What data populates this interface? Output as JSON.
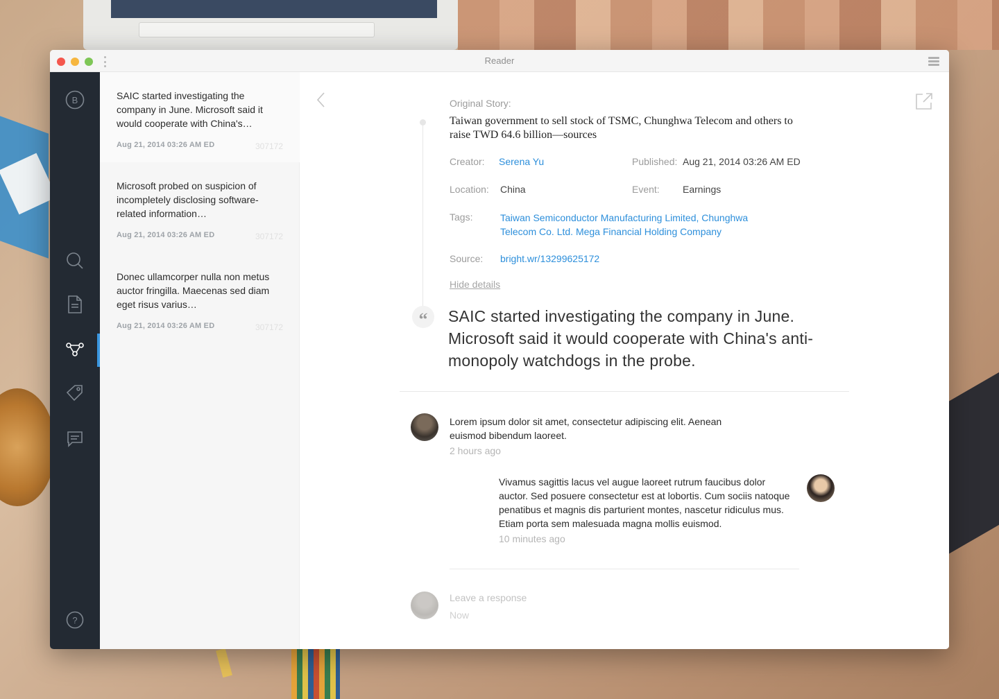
{
  "window": {
    "title": "Reader"
  },
  "sidebar": {
    "logo_letter": "B",
    "items": [
      {
        "name": "search-icon"
      },
      {
        "name": "document-icon"
      },
      {
        "name": "graph-icon",
        "active": true
      },
      {
        "name": "tag-icon"
      },
      {
        "name": "comment-icon"
      }
    ],
    "help": "?"
  },
  "list": {
    "items": [
      {
        "text": "SAIC started investigating the company in June. Microsoft said it would cooperate with China's…",
        "date": "Aug 21, 2014 03:26 AM ED",
        "id": "307172",
        "selected": true
      },
      {
        "text": "Microsoft probed on suspicion of incompletely disclosing software-related information…",
        "date": "Aug 21, 2014 03:26 AM ED",
        "id": "307172"
      },
      {
        "text": "Donec ullamcorper nulla non metus auctor fringilla. Maecenas sed diam eget risus varius…",
        "date": "Aug 21, 2014 03:26 AM ED",
        "id": "307172"
      }
    ]
  },
  "article": {
    "original_story_label": "Original Story:",
    "title": "Taiwan government to sell stock of TSMC, Chunghwa Telecom and others to raise TWD 64.6 billion—sources",
    "creator_label": "Creator:",
    "creator": "Serena Yu",
    "published_label": "Published:",
    "published": "Aug 21, 2014 03:26 AM ED",
    "location_label": "Location:",
    "location": "China",
    "event_label": "Event:",
    "event": "Earnings",
    "tags_label": "Tags:",
    "tags": "Taiwan Semiconductor Manufacturing Limited, Chunghwa Telecom Co. Ltd. Mega Financial Holding Company",
    "source_label": "Source:",
    "source": "bright.wr/13299625172",
    "hide_details": "Hide details",
    "quote_mark": "“",
    "quote": "SAIC started investigating the company in June. Microsoft said it would cooperate with China's anti-monopoly watchdogs in the probe."
  },
  "comments": [
    {
      "text": "Lorem ipsum dolor sit amet, consectetur adipiscing elit. Aenean euismod bibendum laoreet.",
      "time": "2 hours ago"
    },
    {
      "text": "Vivamus sagittis lacus vel augue laoreet rutrum faucibus dolor auctor. Sed posuere consectetur est at lobortis. Cum sociis natoque penatibus et magnis dis parturient montes, nascetur ridiculus mus. Etiam porta sem malesuada magna mollis euismod.",
      "time": "10 minutes ago"
    }
  ],
  "response": {
    "placeholder": "Leave a response",
    "time": "Now"
  },
  "colors": {
    "accent": "#2d8fdb",
    "sidebar_bg": "#232a33",
    "active_indicator": "#3a96e0"
  }
}
